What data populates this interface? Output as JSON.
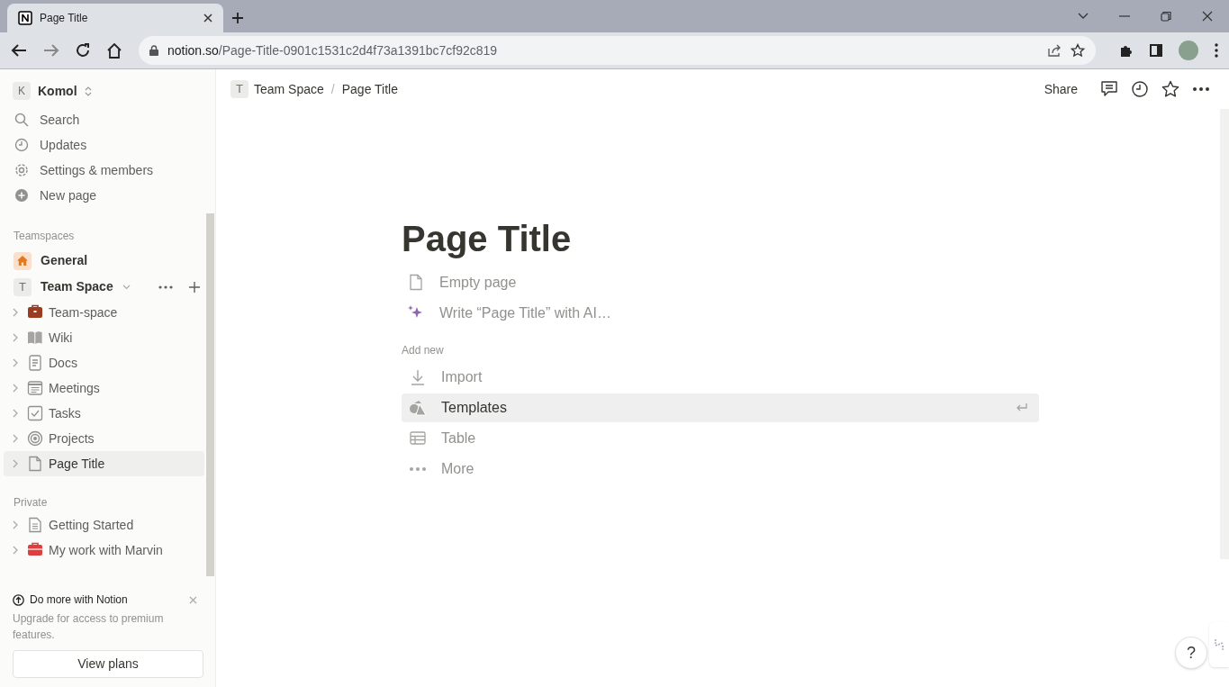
{
  "browser": {
    "tab": {
      "title": "Page Title"
    },
    "address": {
      "host": "notion.so",
      "path": "/Page-Title-0901c1531c2d4f73a1391bc7cf92c819"
    }
  },
  "sidebar": {
    "workspace": {
      "initial": "K",
      "name": "Komol"
    },
    "menu": [
      "Search",
      "Updates",
      "Settings & members",
      "New page"
    ],
    "teamspaces_label": "Teamspaces",
    "teamspaces": [
      {
        "name": "General",
        "kind": "home"
      },
      {
        "name": "Team Space",
        "kind": "letter",
        "initial": "T"
      }
    ],
    "pages": [
      {
        "title": "Team-space",
        "selected": false
      },
      {
        "title": "Wiki",
        "selected": false
      },
      {
        "title": "Docs",
        "selected": false
      },
      {
        "title": "Meetings",
        "selected": false
      },
      {
        "title": "Tasks",
        "selected": false
      },
      {
        "title": "Projects",
        "selected": false
      },
      {
        "title": "Page Title",
        "selected": true
      }
    ],
    "private_label": "Private",
    "private": [
      {
        "title": "Getting Started",
        "selected": false
      },
      {
        "title": "My work with Marvin",
        "selected": false
      }
    ],
    "promo": {
      "title": "Do more with Notion",
      "text": "Upgrade for access to premium features.",
      "button": "View plans"
    }
  },
  "topbar": {
    "breadcrumb": [
      {
        "initial": "T",
        "title": "Team Space"
      },
      {
        "title": "Page Title"
      }
    ],
    "separator": "/",
    "share": "Share"
  },
  "page": {
    "title": "Page Title",
    "options": [
      {
        "label": "Empty page",
        "kind": "page"
      },
      {
        "label": "Write “Page Title” with AI…",
        "kind": "ai"
      }
    ],
    "add_new_label": "Add new",
    "add_new": [
      {
        "label": "Import",
        "selected": false
      },
      {
        "label": "Templates",
        "selected": true
      },
      {
        "label": "Table",
        "selected": false
      },
      {
        "label": "More",
        "selected": false
      }
    ]
  },
  "help": "?"
}
